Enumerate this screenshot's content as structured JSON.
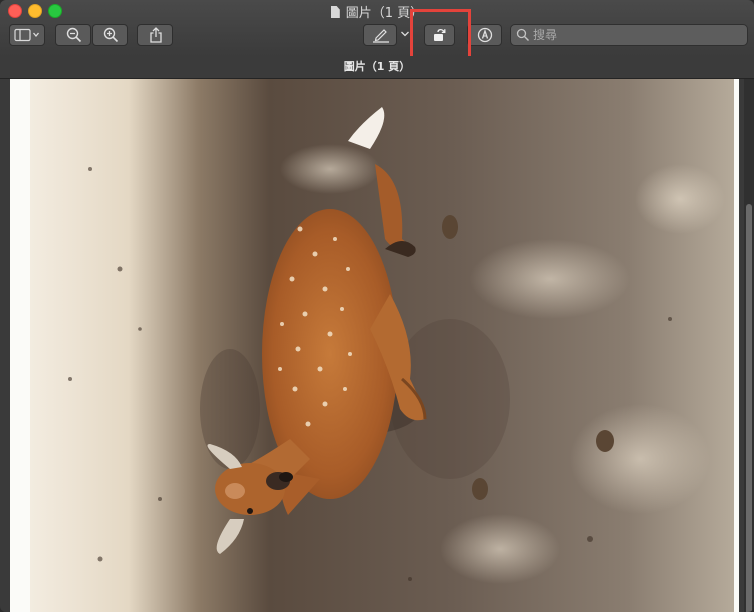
{
  "window": {
    "title": "圖片（1 頁）",
    "subtitle": "圖片（1 頁）"
  },
  "toolbar": {
    "search_placeholder": "搜尋",
    "buttons": [
      "sidebar-view",
      "zoom-out",
      "zoom-in",
      "share",
      "markup",
      "rotate",
      "annotate"
    ],
    "highlight_color": "#e4433b"
  },
  "colors": {
    "titlebar": "#3b3b3b",
    "button": "#5a5a5a",
    "page": "#fbfbf8"
  }
}
